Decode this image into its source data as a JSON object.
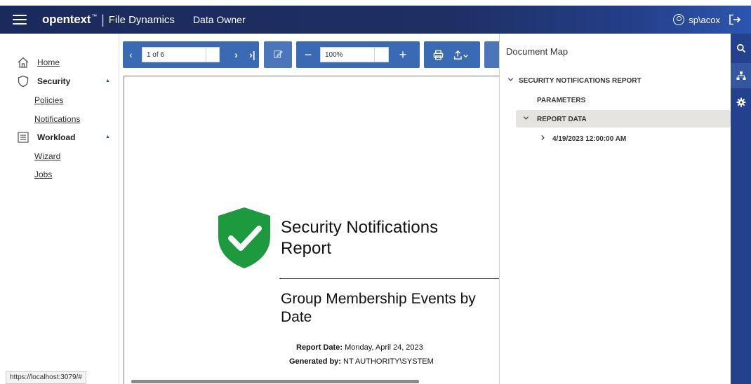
{
  "header": {
    "brand": "opentext",
    "brand_mark": "™",
    "separator": "|",
    "product": "File Dynamics",
    "role": "Data Owner",
    "user": "sp\\acox"
  },
  "sidebar": {
    "home": "Home",
    "security": "Security",
    "policies": "Policies",
    "notifications": "Notifications",
    "workload": "Workload",
    "wizard": "Wizard",
    "jobs": "Jobs",
    "caret_up": "▲"
  },
  "status_url": "https://localhost:3079/#",
  "toolbar": {
    "page": "1 of 6",
    "zoom": "100%",
    "prev": "‹",
    "next": "›",
    "last": "›|",
    "zoom_out": "−",
    "zoom_in": "+"
  },
  "report": {
    "title": "Security Notifications Report",
    "subtitle": "Group Membership Events by Date",
    "report_date_label": "Report Date:",
    "report_date": "Monday, April 24, 2023",
    "generated_by_label": "Generated by:",
    "generated_by": "NT AUTHORITY\\SYSTEM"
  },
  "doc_map": {
    "title": "Document Map",
    "root": "SECURITY NOTIFICATIONS REPORT",
    "parameters": "PARAMETERS",
    "report_data": "REPORT DATA",
    "date_node": "4/19/2023 12:00:00 AM"
  },
  "colors": {
    "header": "#1e2f64",
    "toolbar": "#3b6ab5",
    "rail": "#23418c",
    "shield": "#1e9a3e"
  },
  "icons": [
    "menu-icon",
    "user-icon",
    "logout-icon",
    "home-icon",
    "shield-icon",
    "list-icon",
    "search-icon",
    "sitemap-icon",
    "gear-icon",
    "print-icon",
    "export-icon",
    "edit-icon"
  ]
}
